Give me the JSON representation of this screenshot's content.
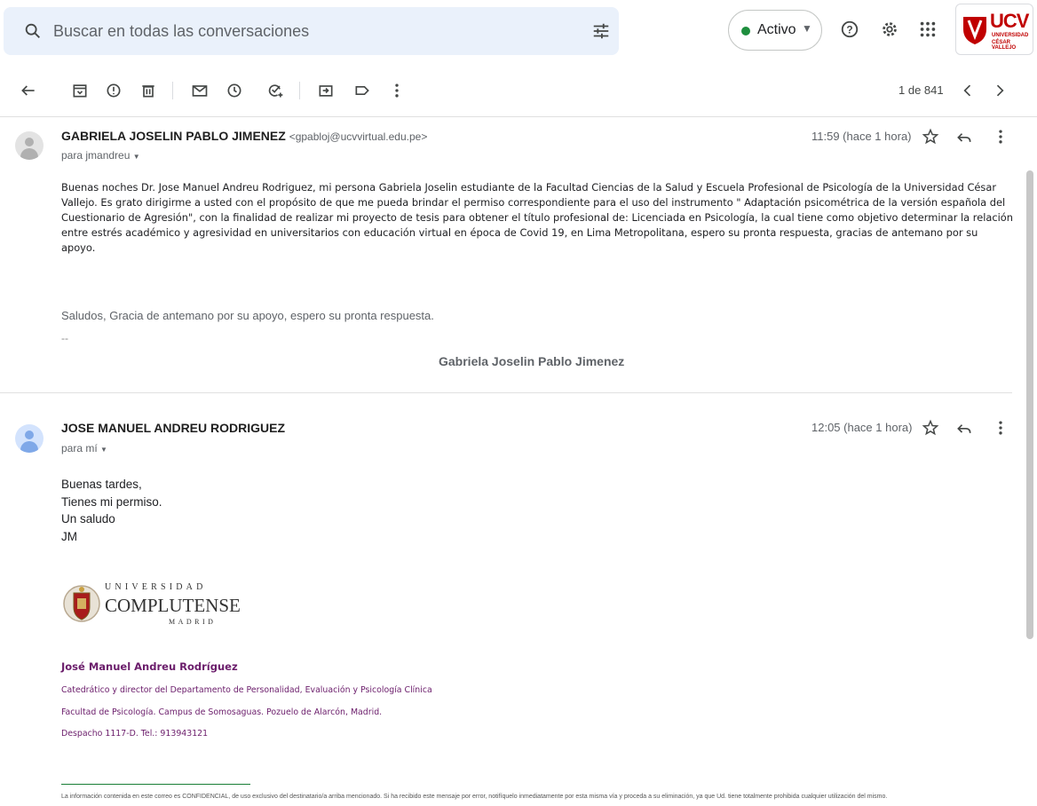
{
  "search": {
    "placeholder": "Buscar en todas las conversaciones"
  },
  "status": {
    "label": "Activo"
  },
  "brand": {
    "name": "UCV",
    "line1": "UNIVERSIDAD",
    "line2": "CÉSAR VALLEJO",
    "color": "#c00000"
  },
  "toolbar": {
    "count": "1 de 841"
  },
  "messages": [
    {
      "sender": "GABRIELA JOSELIN PABLO JIMENEZ",
      "email": "<gpabloj@ucvvirtual.edu.pe>",
      "to": "para jmandreu",
      "time": "11:59 (hace 1 hora)",
      "body": "Buenas noches Dr. Jose Manuel Andreu Rodriguez, mi persona Gabriela Joselin estudiante de la Facultad Ciencias de la Salud y Escuela Profesional de Psicología de la Universidad César Vallejo. Es grato dirigirme a usted con el propósito de que me pueda brindar el permiso correspondiente para el uso del instrumento \" Adaptación psicométrica de la versión española del Cuestionario de Agresión\", con la finalidad de realizar mi proyecto de tesis para obtener el título profesional de: Licenciada en Psicología, la cual tiene como objetivo determinar la relación entre estrés académico y agresividad en universitarios con educación virtual en época de Covid 19, en Lima Metropolitana, espero su pronta respuesta, gracias de antemano por su apoyo.",
      "closing": "Saludos, Gracia de antemano por su apoyo, espero su pronta respuesta.",
      "dash": "--",
      "signature": "Gabriela Joselin Pablo Jimenez"
    },
    {
      "sender": "JOSE MANUEL ANDREU RODRIGUEZ",
      "to": "para mí",
      "time": "12:05 (hace 1 hora)",
      "lines": [
        "Buenas tardes,",
        "Tienes mi permiso.",
        "Un saludo",
        "JM"
      ],
      "university": {
        "line1": "UNIVERSIDAD",
        "line2": "COMPLUTENSE",
        "line3": "MADRID"
      },
      "signature": {
        "name": "José Manuel Andreu Rodríguez",
        "title": "Catedrático y director del Departamento de Personalidad, Evaluación y Psicología Clínica",
        "address": "Facultad de Psicología. Campus de Somosaguas. Pozuelo de Alarcón, Madrid.",
        "office": "Despacho 1117-D. Tel.: 913943121"
      },
      "confidential": "La información contenida en este correo es CONFIDENCIAL, de uso exclusivo del destinatario/a arriba mencionado. Si ha recibido este mensaje por error, notifíquelo inmediatamente por esta misma vía y proceda a su eliminación, ya que Ud. tiene totalmente prohibida cualquier utilización del mismo."
    }
  ]
}
